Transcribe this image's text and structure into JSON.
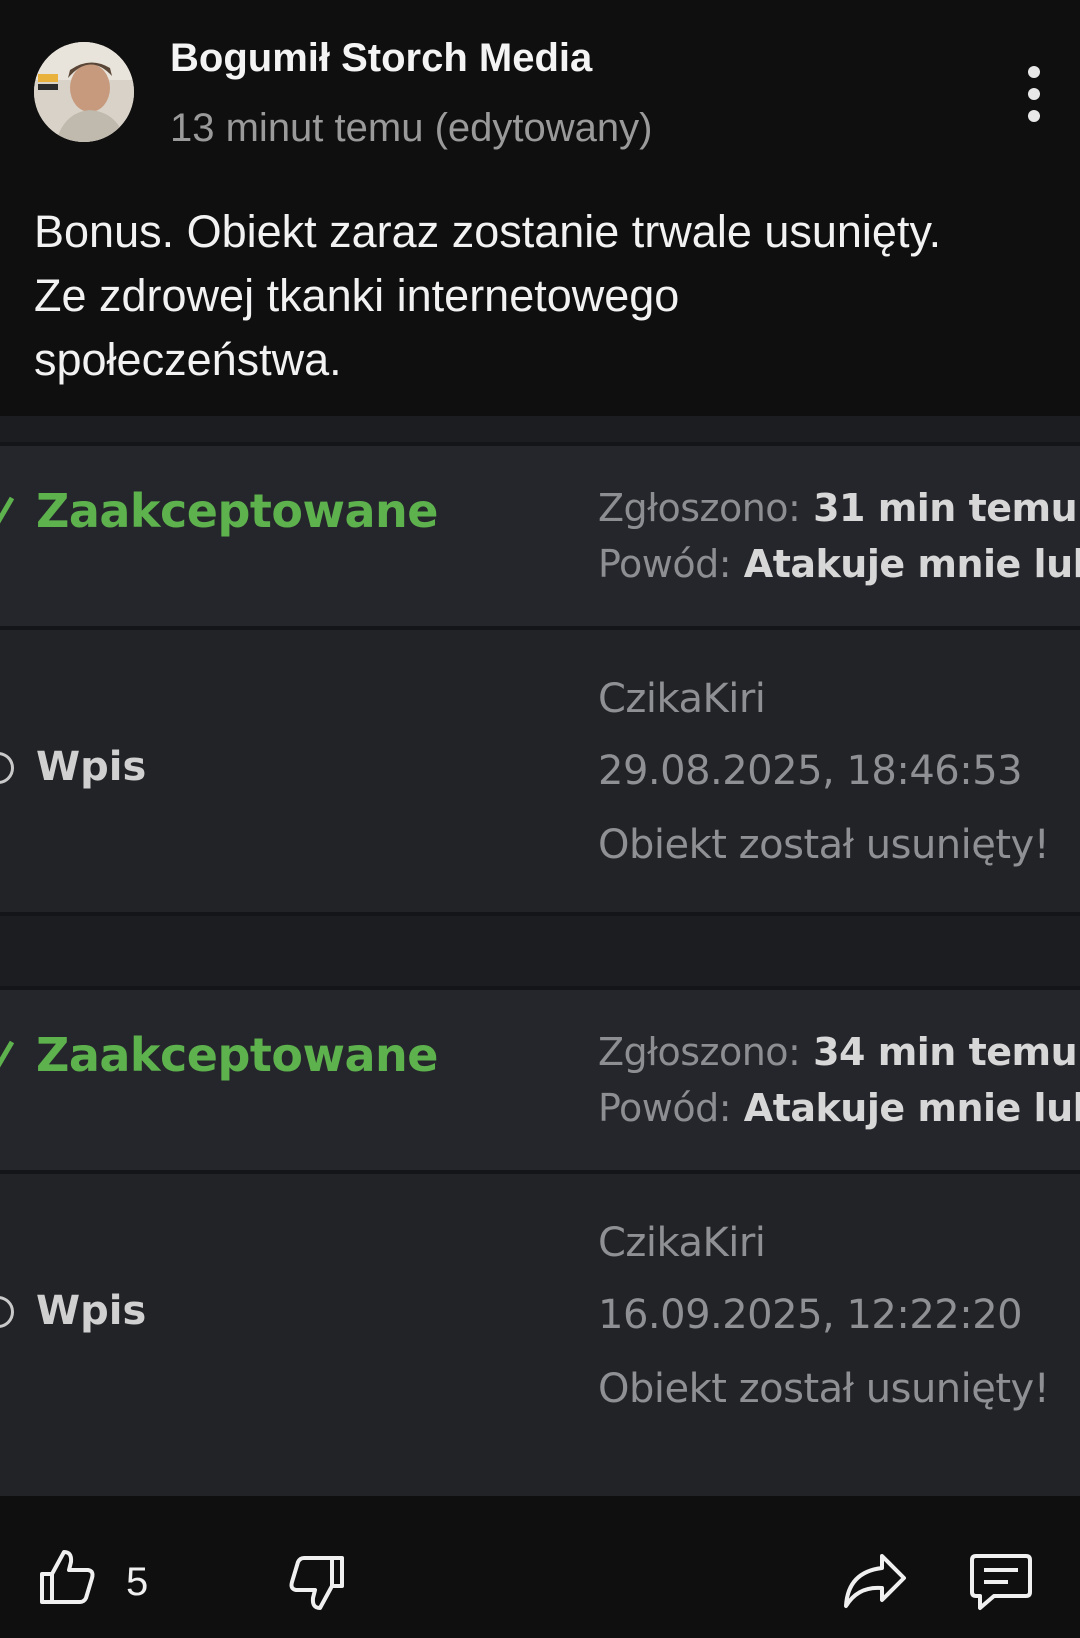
{
  "post": {
    "author": "Bogumił Storch Media",
    "time": "13 minut temu (edytowany)",
    "text_lines": [
      "Bonus. Obiekt zaraz zostanie trwale usunięty.",
      "Ze zdrowej tkanki internetowego",
      "społeczeństwa."
    ]
  },
  "reports": [
    {
      "status": "Zaakceptowane",
      "reported_label": "Zgłoszono:",
      "reported_value": "31 min temu",
      "reason_label": "Powód:",
      "reason_value": "Atakuje mnie lub",
      "type": "Wpis",
      "user": "CzikaKiri",
      "date": "29.08.2025, 18:46:53",
      "result": "Obiekt został usunięty!"
    },
    {
      "status": "Zaakceptowane",
      "reported_label": "Zgłoszono:",
      "reported_value": "34 min temu",
      "reason_label": "Powód:",
      "reason_value": "Atakuje mnie lub",
      "type": "Wpis",
      "user": "CzikaKiri",
      "date": "16.09.2025, 12:22:20",
      "result": "Obiekt został usunięty!"
    }
  ],
  "actions": {
    "like_count": "5"
  },
  "icons": {
    "like": "thumbs-up-icon",
    "dislike": "thumbs-down-icon",
    "share": "share-icon",
    "comment": "comment-icon",
    "more": "more-vertical-icon"
  },
  "colors": {
    "background": "#0f0f10",
    "status_accepted": "#5eb24e"
  }
}
